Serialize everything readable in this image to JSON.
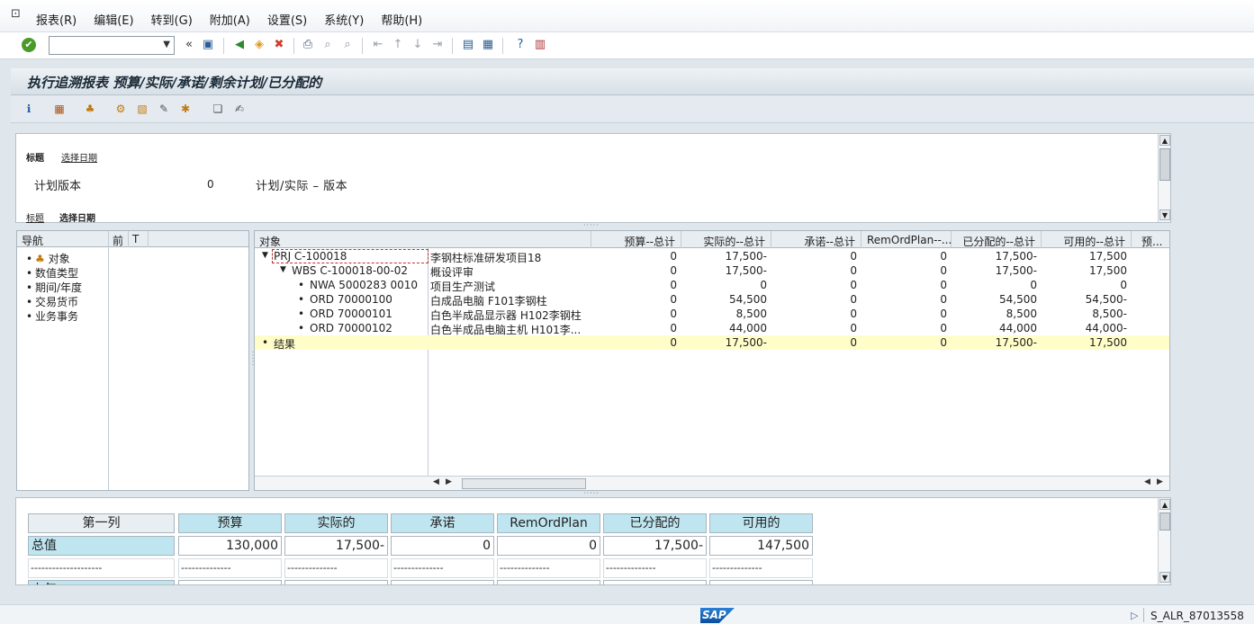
{
  "menu": {
    "items": [
      "报表(R)",
      "编辑(E)",
      "转到(G)",
      "附加(A)",
      "设置(S)",
      "系统(Y)",
      "帮助(H)"
    ]
  },
  "toolbar": {
    "command_field": "",
    "icons": [
      "check-icon",
      "save-icon",
      "back-icon",
      "exit-icon",
      "cancel-icon",
      "print-icon",
      "find-icon",
      "find-next-icon",
      "first-page-icon",
      "prev-page-icon",
      "next-page-icon",
      "last-page-icon",
      "new-session-icon",
      "shortcut-icon",
      "help-icon",
      "customize-layout-icon"
    ]
  },
  "title": "执行追溯报表 预算/实际/承诺/剩余计划/已分配的",
  "header": {
    "tab_title": "标题",
    "tab_selection_date": "选择日期",
    "label": "计划版本",
    "value": "0",
    "description": "计划/实际 – 版本"
  },
  "navigation": {
    "title": "导航",
    "col2": "前",
    "col3": "T",
    "items": [
      "对象",
      "数值类型",
      "期间/年度",
      "交易货币",
      "业务事务"
    ]
  },
  "grid": {
    "columns": [
      "对象",
      "预算--总计",
      "实际的--总计",
      "承诺--总计",
      "RemOrdPlan--...",
      "已分配的--总计",
      "可用的--总计",
      "预..."
    ],
    "rows": [
      {
        "marker": "▼",
        "object": "PRJ C-100018",
        "desc": "李钢柱标准研发项目18",
        "budget": "0",
        "actual": "17,500-",
        "commit": "0",
        "remord": "0",
        "allocated": "17,500-",
        "available": "17,500"
      },
      {
        "marker": "▼",
        "object": "WBS C-100018-00-02",
        "desc": "概设评审",
        "budget": "0",
        "actual": "17,500-",
        "commit": "0",
        "remord": "0",
        "allocated": "17,500-",
        "available": "17,500"
      },
      {
        "marker": "•",
        "object": "NWA 5000283 0010",
        "desc": "项目生产测试",
        "budget": "0",
        "actual": "0",
        "commit": "0",
        "remord": "0",
        "allocated": "0",
        "available": "0"
      },
      {
        "marker": "•",
        "object": "ORD 70000100",
        "desc": "白成品电脑 F101李钢柱",
        "budget": "0",
        "actual": "54,500",
        "commit": "0",
        "remord": "0",
        "allocated": "54,500",
        "available": "54,500-"
      },
      {
        "marker": "•",
        "object": "ORD 70000101",
        "desc": "白色半成品显示器 H102李钢柱",
        "budget": "0",
        "actual": "8,500",
        "commit": "0",
        "remord": "0",
        "allocated": "8,500",
        "available": "8,500-"
      },
      {
        "marker": "•",
        "object": "ORD 70000102",
        "desc": "白色半成品电脑主机 H101李...",
        "budget": "0",
        "actual": "44,000",
        "commit": "0",
        "remord": "0",
        "allocated": "44,000",
        "available": "44,000-"
      },
      {
        "marker": "•",
        "object": "结果",
        "desc": "",
        "budget": "0",
        "actual": "17,500-",
        "commit": "0",
        "remord": "0",
        "allocated": "17,500-",
        "available": "17,500"
      }
    ]
  },
  "bottom_table": {
    "headers": [
      "第一列",
      "预算",
      "实际的",
      "承诺",
      "RemOrdPlan",
      "已分配的",
      "可用的"
    ],
    "total_label": "总值",
    "total_values": [
      "130,000",
      "17,500-",
      "0",
      "0",
      "17,500-",
      "147,500"
    ],
    "dash_first": "--------------------",
    "dash_other": "--------------",
    "next_label": "上年"
  },
  "status": {
    "logo": "SAP",
    "system": "S_ALR_87013558"
  },
  "colors": {
    "header_cell": "#bfe6f0",
    "result_row": "#fffdc8",
    "ok_green": "#4a9b2c"
  }
}
